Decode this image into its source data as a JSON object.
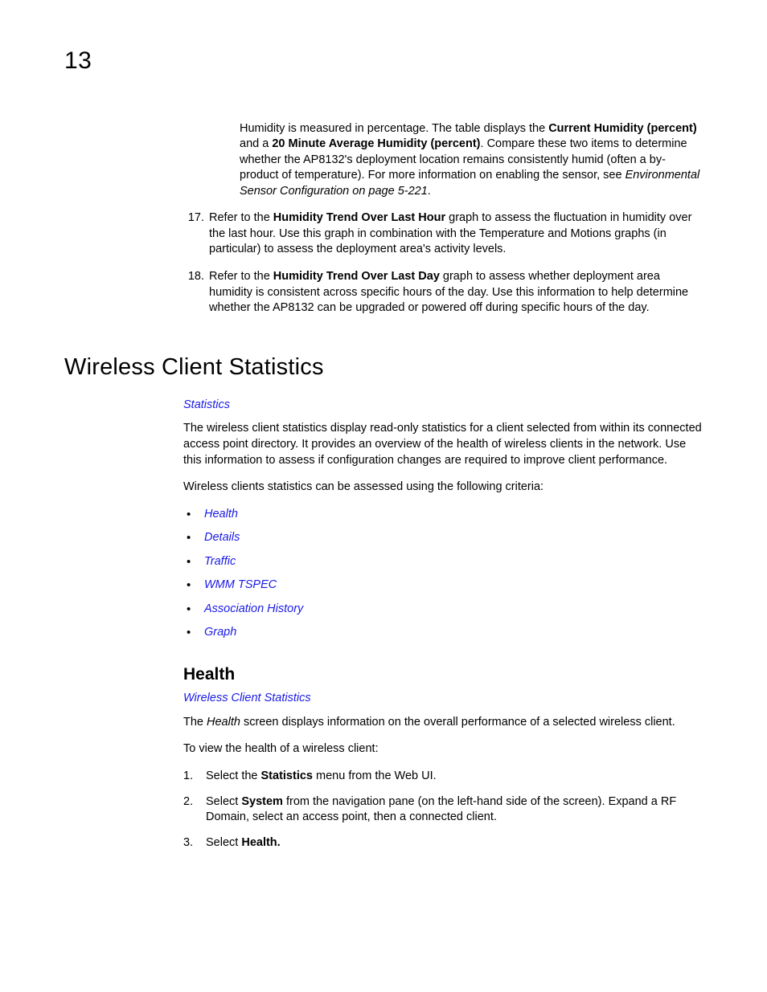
{
  "chapter_number": "13",
  "top": {
    "p16_prefix": "Humidity is measured in percentage. The table displays the ",
    "p16_b1": "Current Humidity (percent)",
    "p16_mid1": " and a ",
    "p16_b2": "20 Minute Average Humidity (percent)",
    "p16_mid2": ". Compare these two items to determine whether the AP8132's deployment location remains consistently humid (often a by-product of temperature). For more information on enabling the sensor, see ",
    "p16_i": "Environmental Sensor Configuration on page 5-221",
    "p16_end": ".",
    "n17": "17.",
    "p17_a": "Refer to the ",
    "p17_b": "Humidity Trend Over Last Hour",
    "p17_c": " graph to assess the fluctuation in humidity over the last hour. Use this graph in combination with the Temperature and Motions graphs (in particular) to assess the deployment area's activity levels.",
    "n18": "18.",
    "p18_a": "Refer to the ",
    "p18_b": "Humidity Trend Over Last Day",
    "p18_c": " graph to assess whether deployment area humidity is consistent across specific hours of the day. Use this information to help determine whether the AP8132 can be upgraded or powered off during specific hours of the day."
  },
  "h1": "Wireless Client Statistics",
  "wcs": {
    "top_link": "Statistics",
    "intro": "The wireless client statistics display read-only statistics for a client selected from within its connected access point directory. It provides an overview of the health of wireless clients in the network. Use this information to assess if configuration changes are required to improve client performance.",
    "criteria_line": "Wireless clients statistics can be assessed using the following criteria:",
    "links": [
      "Health",
      "Details",
      "Traffic",
      "WMM TSPEC",
      "Association History",
      "Graph"
    ]
  },
  "health": {
    "heading": "Health",
    "parent_link": "Wireless Client Statistics",
    "desc_a": "The ",
    "desc_i": "Health",
    "desc_b": " screen displays information on the overall performance of a selected wireless client.",
    "steps_intro": "To view the health of a wireless client:",
    "s1n": "1.",
    "s1a": "Select the ",
    "s1b": "Statistics",
    "s1c": " menu from the Web UI.",
    "s2n": "2.",
    "s2a": "Select ",
    "s2b": "System",
    "s2c": " from the navigation pane (on the left-hand side of the screen). Expand a RF Domain, select  an access point, then a connected client.",
    "s3n": "3.",
    "s3a": "Select ",
    "s3b": "Health."
  }
}
